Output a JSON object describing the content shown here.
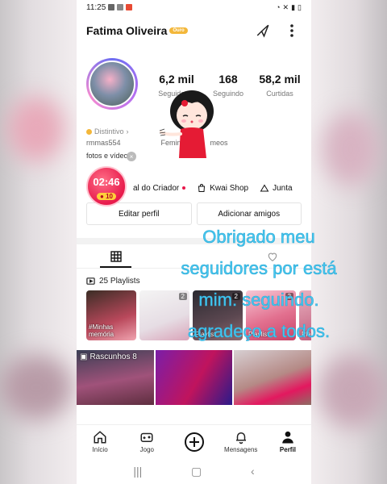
{
  "statusbar": {
    "time": "11:25"
  },
  "header": {
    "name": "Fatima Oliveira",
    "badge": "Ouro"
  },
  "stats": [
    {
      "value": "6,2 mil",
      "label": "Seguidores"
    },
    {
      "value": "168",
      "label": "Seguindo"
    },
    {
      "value": "58,2 mil",
      "label": "Curtidas"
    }
  ],
  "bio": {
    "distintivo": "Distintivo",
    "handle": "rmmas554",
    "gender": "Feminino",
    "age_suffix": "meos",
    "text": "fotos e vídeos."
  },
  "live_timer": {
    "time": "02:46",
    "coins": "10"
  },
  "creator_row": {
    "creator": "al do Criador",
    "shop": "Kwai Shop",
    "join": "Junta"
  },
  "buttons": {
    "edit": "Editar perfil",
    "add": "Adicionar amigos"
  },
  "playlists": {
    "title": "25 Playlists",
    "items": [
      {
        "label": "#Minhas memória",
        "count": ""
      },
      {
        "label": "",
        "count": "2"
      },
      {
        "label": "Playlist",
        "count": "2"
      },
      {
        "label": "Playlist",
        "count": "2"
      },
      {
        "label": "Pla",
        "count": ""
      }
    ]
  },
  "drafts": {
    "label": "Rascunhos 8"
  },
  "overlay": {
    "lines": [
      "Obrigado meu",
      "seguidores por está",
      "mim. seguindo.",
      "agradeço a todos."
    ]
  },
  "nav": {
    "home": "Início",
    "game": "Jogo",
    "messages": "Mensagens",
    "profile": "Perfil"
  },
  "colors": {
    "accent": "#e8174a",
    "overlay_text": "#48c9f0",
    "badge": "#f3b73a"
  }
}
